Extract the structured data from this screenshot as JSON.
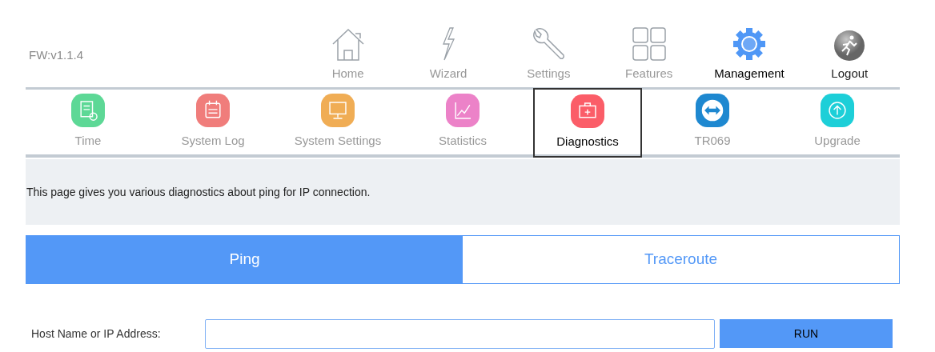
{
  "firmware": "FW:v1.1.4",
  "top_nav": [
    {
      "label": "Home",
      "kind": "home",
      "selected": false
    },
    {
      "label": "Wizard",
      "kind": "wizard",
      "selected": false
    },
    {
      "label": "Settings",
      "kind": "settings",
      "selected": false
    },
    {
      "label": "Features",
      "kind": "features",
      "selected": false
    },
    {
      "label": "Management",
      "kind": "management",
      "selected": true
    },
    {
      "label": "Logout",
      "kind": "logout",
      "selected": false
    }
  ],
  "sub_nav": [
    {
      "label": "Time",
      "kind": "time",
      "color": "#5dd896",
      "selected": false
    },
    {
      "label": "System Log",
      "kind": "log",
      "color": "#f07d7b",
      "selected": false
    },
    {
      "label": "System Settings",
      "kind": "monitor",
      "color": "#f0ad55",
      "selected": false
    },
    {
      "label": "Statistics",
      "kind": "chart",
      "color": "#ec82c8",
      "selected": false
    },
    {
      "label": "Diagnostics",
      "kind": "kit",
      "color": "#fb5d68",
      "selected": true
    },
    {
      "label": "TR069",
      "kind": "remote",
      "color": "#1e88d0",
      "selected": false
    },
    {
      "label": "Upgrade",
      "kind": "upgrade",
      "color": "#1dcfd8",
      "selected": false
    }
  ],
  "description": "This page gives you various diagnostics about ping for IP connection.",
  "tabs": [
    {
      "label": "Ping",
      "selected": true
    },
    {
      "label": "Traceroute",
      "selected": false
    }
  ],
  "host_field": {
    "label": "Host Name or IP Address:"
  },
  "run_button": "RUN"
}
